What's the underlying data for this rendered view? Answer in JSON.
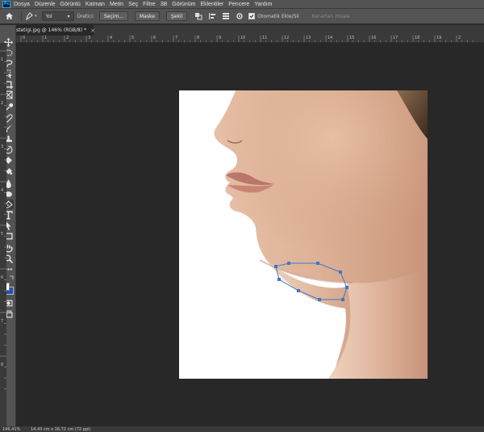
{
  "app": {
    "logo": "Ps"
  },
  "menu": [
    "Dosya",
    "Düzenle",
    "Görüntü",
    "Katman",
    "Metin",
    "Seç",
    "Filtre",
    "3B",
    "Görünüm",
    "Eklentiler",
    "Pencere",
    "Yardım"
  ],
  "options": {
    "mode_select": "Yol",
    "mode_label": "Üretici:",
    "button_selection": "Seçim...",
    "button_mask": "Maske",
    "button_shape": "Şekil",
    "auto_add_label": "Otomatik Ekle/Sil",
    "align_edges_label": "Kenarları Hizala"
  },
  "tab": {
    "title": "stetigi.jpg @ 146% (RGB/8) *",
    "close": "×"
  },
  "ruler_top": [
    "0",
    "1",
    "2",
    "3",
    "4",
    "5",
    "6",
    "7",
    "8",
    "9",
    "10",
    "11",
    "12",
    "13",
    "14",
    "15",
    "16",
    "17",
    "18",
    "19",
    "2"
  ],
  "ruler_left": [
    "1",
    "2",
    "3",
    "4",
    "5",
    "6",
    "7",
    "8"
  ],
  "status": {
    "zoom": "146,41%",
    "doc_size": "14,43 cm x 16,72 cm (72 ppi)"
  },
  "colors": {
    "path_stroke": "#3f78c8",
    "foreground": "#ffffff",
    "background": "#1d4fbf"
  },
  "tools": [
    "move-icon",
    "marquee-icon",
    "lasso-icon",
    "object-select-icon",
    "crop-icon",
    "frame-icon",
    "eyedropper-icon",
    "healing-icon",
    "brush-icon",
    "stamp-icon",
    "history-brush-icon",
    "eraser-icon",
    "gradient-icon",
    "blur-icon",
    "dodge-icon",
    "pen-icon",
    "type-icon",
    "path-select-icon",
    "rectangle-icon",
    "hand-icon",
    "zoom-icon",
    "more-icon"
  ]
}
